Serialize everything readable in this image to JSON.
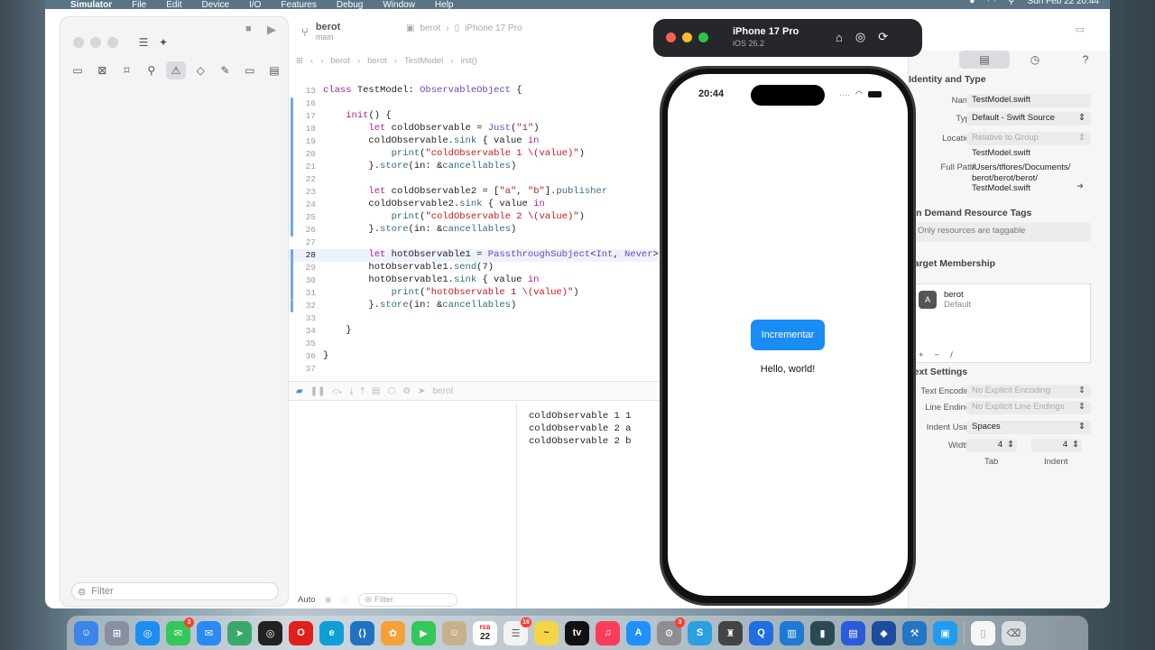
{
  "menubar": {
    "items": [
      "Simulator",
      "File",
      "Edit",
      "Device",
      "I/O",
      "Features",
      "Debug",
      "Window",
      "Help"
    ],
    "clock": "Sun Feb 22  20:44"
  },
  "toolbar": {
    "project": "berot",
    "branch": "main",
    "run_scheme": "berot",
    "run_device": "iPhone 17 Pro"
  },
  "jumpbar": {
    "crumbs": [
      "berot",
      "berot",
      "TestModel",
      "init()"
    ]
  },
  "editor": {
    "lines": [
      {
        "n": "13",
        "segs": [
          [
            "kw",
            "class "
          ],
          [
            "",
            "TestModel: "
          ],
          [
            "ty",
            "ObservableObject"
          ],
          [
            "",
            " {"
          ]
        ]
      },
      {
        "n": "16",
        "segs": []
      },
      {
        "n": "17",
        "segs": [
          [
            "",
            "    "
          ],
          [
            "kw",
            "init"
          ],
          [
            "",
            "() {"
          ]
        ]
      },
      {
        "n": "18",
        "segs": [
          [
            "",
            "        "
          ],
          [
            "kw",
            "let "
          ],
          [
            "",
            "coldObservable = "
          ],
          [
            "ty",
            "Just"
          ],
          [
            "",
            "("
          ],
          [
            "st",
            "\"1\""
          ],
          [
            "",
            ")"
          ]
        ]
      },
      {
        "n": "19",
        "segs": [
          [
            "",
            "        coldObservable."
          ],
          [
            "pr",
            "sink"
          ],
          [
            "",
            " { value "
          ],
          [
            "kw",
            "in"
          ]
        ]
      },
      {
        "n": "20",
        "segs": [
          [
            "",
            "            "
          ],
          [
            "fn",
            "print"
          ],
          [
            "",
            "("
          ],
          [
            "st",
            "\"coldObservable 1 \\(value)\""
          ],
          [
            "",
            ")"
          ]
        ]
      },
      {
        "n": "21",
        "segs": [
          [
            "",
            "        }."
          ],
          [
            "pr",
            "store"
          ],
          [
            "",
            "(in: &"
          ],
          [
            "pr",
            "cancellables"
          ],
          [
            "",
            ")"
          ]
        ]
      },
      {
        "n": "22",
        "segs": []
      },
      {
        "n": "23",
        "segs": [
          [
            "",
            "        "
          ],
          [
            "kw",
            "let "
          ],
          [
            "",
            "coldObservable2 = ["
          ],
          [
            "st",
            "\"a\""
          ],
          [
            "",
            ", "
          ],
          [
            "st",
            "\"b\""
          ],
          [
            "",
            "]."
          ],
          [
            "pr",
            "publisher"
          ]
        ]
      },
      {
        "n": "24",
        "segs": [
          [
            "",
            "        coldObservable2."
          ],
          [
            "pr",
            "sink"
          ],
          [
            "",
            " { value "
          ],
          [
            "kw",
            "in"
          ]
        ]
      },
      {
        "n": "25",
        "segs": [
          [
            "",
            "            "
          ],
          [
            "fn",
            "print"
          ],
          [
            "",
            "("
          ],
          [
            "st",
            "\"coldObservable 2 \\(value)\""
          ],
          [
            "",
            ")"
          ]
        ]
      },
      {
        "n": "26",
        "segs": [
          [
            "",
            "        }."
          ],
          [
            "pr",
            "store"
          ],
          [
            "",
            "(in: &"
          ],
          [
            "pr",
            "cancellables"
          ],
          [
            "",
            ")"
          ]
        ]
      },
      {
        "n": "27",
        "segs": []
      },
      {
        "n": "28",
        "segs": [
          [
            "",
            "        "
          ],
          [
            "kw",
            "let "
          ],
          [
            "",
            "hotObservable1 = "
          ],
          [
            "ty",
            "PassthroughSubject"
          ],
          [
            "",
            "<"
          ],
          [
            "ty",
            "Int"
          ],
          [
            "",
            ", "
          ],
          [
            "ty",
            "Never"
          ],
          [
            "",
            ">()"
          ]
        ]
      },
      {
        "n": "29",
        "segs": [
          [
            "",
            "        hotObservable1."
          ],
          [
            "pr",
            "send"
          ],
          [
            "",
            "(7)"
          ]
        ]
      },
      {
        "n": "30",
        "segs": [
          [
            "",
            "        hotObservable1."
          ],
          [
            "pr",
            "sink"
          ],
          [
            "",
            " { value "
          ],
          [
            "kw",
            "in"
          ]
        ]
      },
      {
        "n": "31",
        "segs": [
          [
            "",
            "            "
          ],
          [
            "fn",
            "print"
          ],
          [
            "",
            "("
          ],
          [
            "st",
            "\"hotObservable 1 \\(value)\""
          ],
          [
            "",
            ")"
          ]
        ]
      },
      {
        "n": "32",
        "segs": [
          [
            "",
            "        }."
          ],
          [
            "pr",
            "store"
          ],
          [
            "",
            "(in: &"
          ],
          [
            "pr",
            "cancellables"
          ],
          [
            "",
            ")"
          ]
        ]
      },
      {
        "n": "33",
        "segs": []
      },
      {
        "n": "34",
        "segs": [
          [
            "",
            "    }"
          ]
        ]
      },
      {
        "n": "35",
        "segs": []
      },
      {
        "n": "36",
        "segs": [
          [
            "",
            "}"
          ]
        ]
      },
      {
        "n": "37",
        "segs": []
      }
    ],
    "current_line": "28"
  },
  "debug": {
    "target": "berot"
  },
  "console": {
    "lines": [
      "coldObservable 1 1",
      "coldObservable 2 a",
      "coldObservable 2 b"
    ],
    "auto_label": "Auto",
    "filter_placeholder": "Filter"
  },
  "navigator": {
    "filter_placeholder": "Filter"
  },
  "inspector": {
    "identity_header": "Identity and Type",
    "name_label": "Name",
    "name_value": "TestModel.swift",
    "type_label": "Type",
    "type_value": "Default - Swift Source",
    "location_label": "Location",
    "location_value": "Relative to Group",
    "location_file": "TestModel.swift",
    "fullpath_label": "Full Path",
    "fullpath_value": [
      "/Users/tflores/Documents/",
      "berot/berot/berot/",
      "TestModel.swift"
    ],
    "odr_header": "On Demand Resource Tags",
    "odr_note": "Only resources are taggable",
    "target_header": "Target Membership",
    "target_name": "berot",
    "target_sub": "Default",
    "text_header": "Text Settings",
    "encoding_label": "Text Encoding",
    "encoding_value": "No Explicit Encoding",
    "endings_label": "Line Endings",
    "endings_value": "No Explicit Line Endings",
    "indent_label": "Indent Using",
    "indent_value": "Spaces",
    "widths_label": "Widths",
    "tab_value": "4",
    "indent_num": "4",
    "tab_label": "Tab",
    "indent_label2": "Indent"
  },
  "simulator": {
    "device": "iPhone 17 Pro",
    "os": "iOS 26.2",
    "time": "20:44",
    "button_label": "Incrementar",
    "hello": "Hello, world!"
  },
  "dock": {
    "badges": {
      "messages": "3",
      "mail": "",
      "calendar_day": "22",
      "calendar_month": "FEB",
      "reminders": "16",
      "settings": "3"
    }
  }
}
